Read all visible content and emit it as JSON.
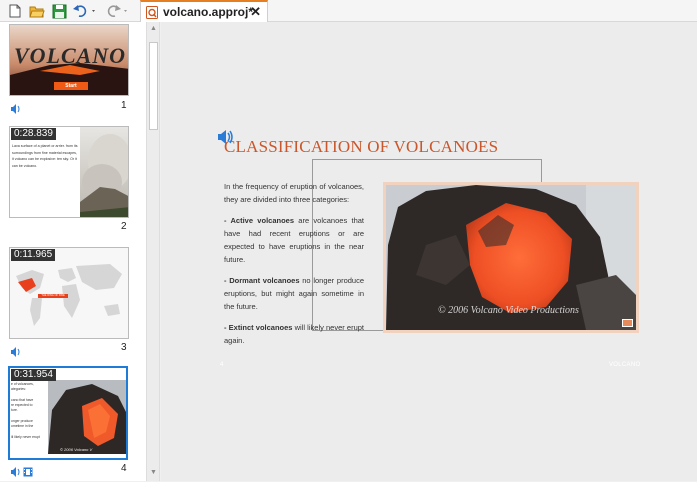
{
  "toolbar": {
    "icons": [
      "new-file-icon",
      "open-folder-icon",
      "save-icon",
      "undo-icon",
      "redo-icon"
    ],
    "tab": {
      "label": "volcano.approj*",
      "close": "✕"
    }
  },
  "slides": [
    {
      "number": "1",
      "title": "VOLCANO",
      "button": "Start",
      "duration": ""
    },
    {
      "number": "2",
      "duration": "0:28.839",
      "text": "Lava surface of a planet or arrier. from its surroundings from fine material escapes, it volcano can be explosive: ten sky. Or it can be volcano."
    },
    {
      "number": "3",
      "duration": "0:11.965",
      "map_label": "THE RING OF FIRE"
    },
    {
      "number": "4",
      "duration": "0:31.954",
      "text_lines": [
        "e of volcanoes,",
        "ategories:",
        "cano that have",
        "re expected to",
        "ture.",
        "onger produce",
        "ometime in the",
        "ill likely never erupt"
      ],
      "watermark": "© 2006 Volcano V"
    }
  ],
  "slide": {
    "title": "CLASSIFICATION OF VOLCANOES",
    "intro": "In the frequency of eruption of volcanoes, they are divided into three categories:",
    "active_bold": "- Active volcanoes",
    "active_rest": " are volcanoes that have had recent eruptions or are expected to have eruptions in the near future.",
    "dormant_bold": "- Dormant volcanoes",
    "dormant_rest": " no longer produce eruptions, but might again sometime in the future.",
    "extinct_bold": "- Extinct volcanoes",
    "extinct_rest": " will likely never erupt again.",
    "video_caption": "© 2006 Volcano Video Productions",
    "page_number": "4",
    "footer": "VOLCANO"
  },
  "colors": {
    "accent_orange": "#e67e22",
    "selection_blue": "#1e7bd6",
    "title_color": "#c9572b",
    "lava": "#f0592a"
  }
}
